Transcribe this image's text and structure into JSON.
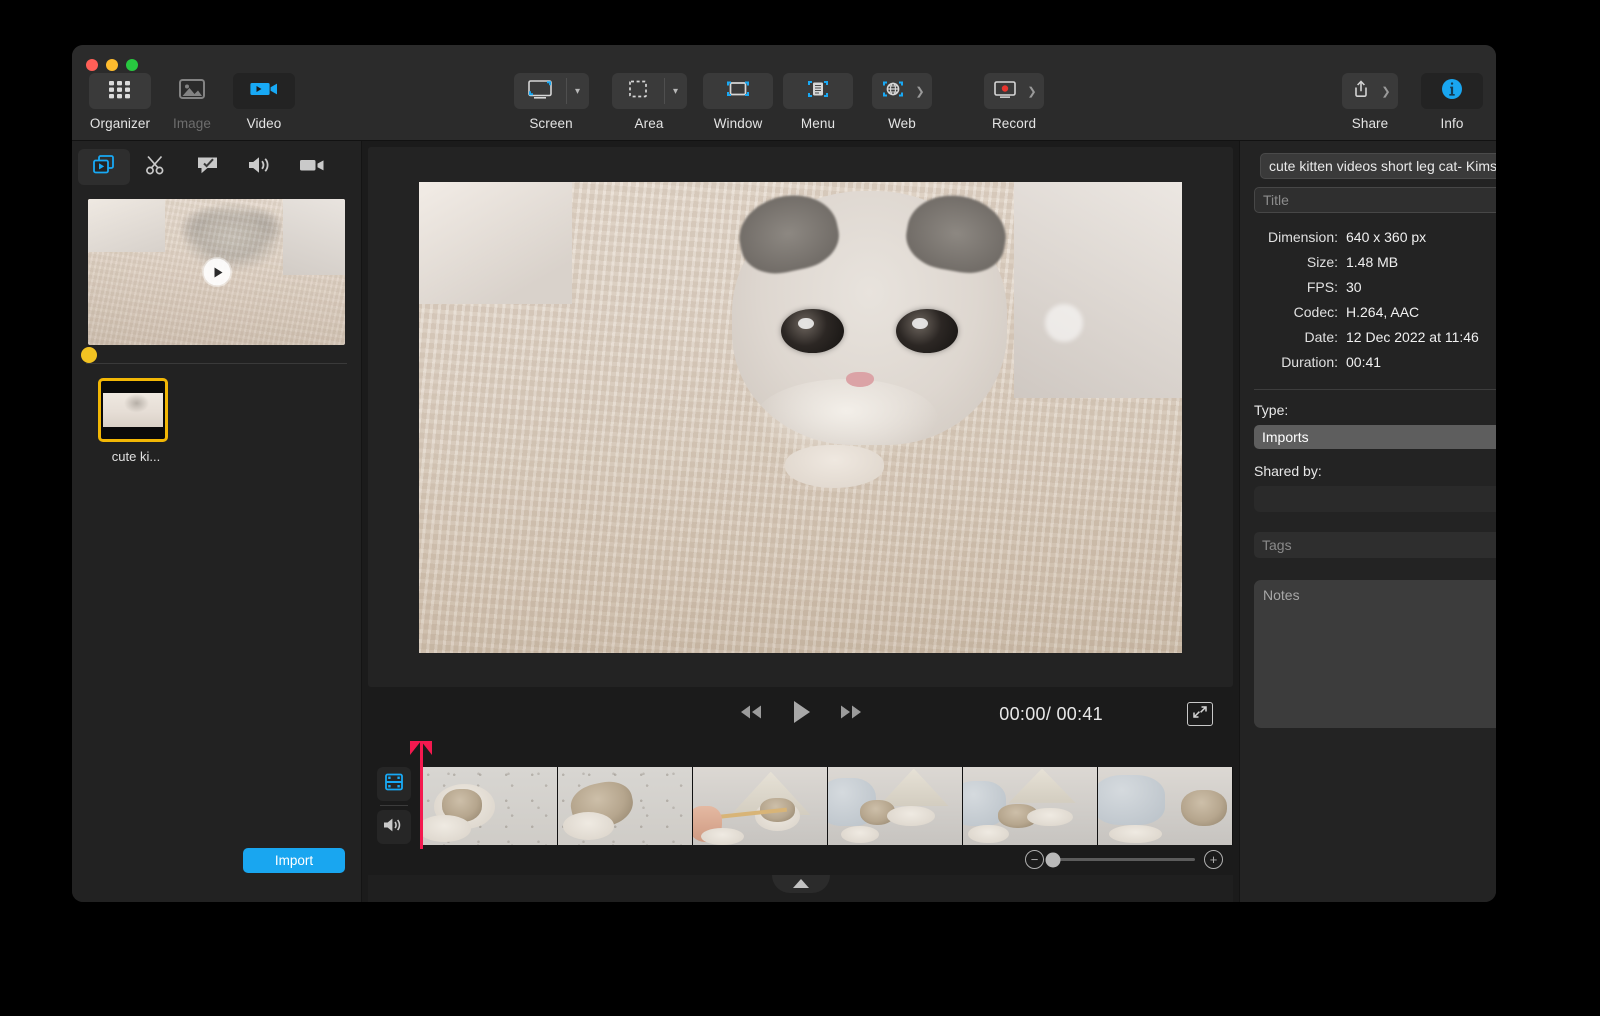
{
  "window": {
    "traffic_lights": [
      "close",
      "minimize",
      "maximize"
    ]
  },
  "toolbar": {
    "left_items": [
      {
        "label": "Organizer",
        "icon": "grid-icon",
        "state": "active"
      },
      {
        "label": "Image",
        "icon": "picture-icon",
        "state": "disabled"
      },
      {
        "label": "Video",
        "icon": "video-camera-icon",
        "state": "selected"
      }
    ],
    "capture_items": [
      {
        "label": "Screen",
        "icon": "screen-icon",
        "has_chevron": true
      },
      {
        "label": "Area",
        "icon": "dashed-rect-icon",
        "has_chevron": true
      },
      {
        "label": "Window",
        "icon": "window-crop-icon",
        "has_chevron": false
      },
      {
        "label": "Menu",
        "icon": "menu-crop-icon",
        "has_chevron": false
      },
      {
        "label": "Web",
        "icon": "globe-crop-icon",
        "has_arrow": true
      },
      {
        "label": "Record",
        "icon": "record-screen-icon",
        "has_arrow": true
      }
    ],
    "right_items": [
      {
        "label": "Share",
        "icon": "share-icon",
        "has_arrow": true
      },
      {
        "label": "Info",
        "icon": "info-circle-icon",
        "state": "selected"
      }
    ]
  },
  "sidebar": {
    "tabs": [
      {
        "name": "media-library-tab",
        "icon": "video-layers-icon",
        "active": true
      },
      {
        "name": "trim-tab",
        "icon": "scissors-icon",
        "active": false
      },
      {
        "name": "annotate-tab",
        "icon": "callout-icon",
        "active": false
      },
      {
        "name": "audio-tab",
        "icon": "speaker-icon",
        "active": false
      },
      {
        "name": "record-tab",
        "icon": "camcorder-icon",
        "active": false
      }
    ],
    "preview": {
      "play_badge": "play-icon",
      "status_dot_color": "#f2c322"
    },
    "media_items": [
      {
        "caption": "cute ki...",
        "selected": true
      }
    ],
    "import_label": "Import"
  },
  "player": {
    "rewind_icon": "rewind-icon",
    "play_icon": "play-icon",
    "forward_icon": "fast-forward-icon",
    "current_time": "00:00",
    "total_time": "00:41",
    "time_separator": "/",
    "fullscreen_icon": "fullscreen-icon"
  },
  "timeline": {
    "video_track_icon": "filmstrip-icon",
    "audio_track_icon": "speaker-icon",
    "playhead_color": "#f4194f",
    "frames": [
      {
        "id": "frame-1",
        "style": "dotted-cat-left"
      },
      {
        "id": "frame-2",
        "style": "dotted-cat-roll"
      },
      {
        "id": "frame-3",
        "style": "tent-stick-hand"
      },
      {
        "id": "frame-4",
        "style": "room-pillow-cat"
      },
      {
        "id": "frame-5",
        "style": "room-cat-ball"
      },
      {
        "id": "frame-6",
        "style": "room-cat-right"
      }
    ],
    "zoom_out_icon": "zoom-out-icon",
    "zoom_in_icon": "zoom-in-icon",
    "zoom_value": 0
  },
  "bottom": {
    "disclosure_icon": "triangle-up-icon"
  },
  "info": {
    "filename": "cute kitten videos short leg cat- Kims",
    "title_placeholder": "Title",
    "metadata": [
      {
        "label": "Dimension:",
        "value": "640 x 360 px"
      },
      {
        "label": "Size:",
        "value": "1.48 MB"
      },
      {
        "label": "FPS:",
        "value": "30"
      },
      {
        "label": "Codec:",
        "value": "H.264, AAC"
      },
      {
        "label": "Date:",
        "value": "12 Dec 2022 at 11:46"
      },
      {
        "label": "Duration:",
        "value": "00:41"
      }
    ],
    "type_label": "Type:",
    "type_value": "Imports",
    "shared_by_label": "Shared by:",
    "shared_by_value": "",
    "tags_placeholder": "Tags",
    "notes_placeholder": "Notes"
  },
  "colors": {
    "accent_blue": "#19a6f0",
    "selection_yellow": "#f2b705",
    "playhead_red": "#f4194f",
    "window_bg": "#1f1f1f",
    "toolbar_bg": "#2b2b2b"
  }
}
